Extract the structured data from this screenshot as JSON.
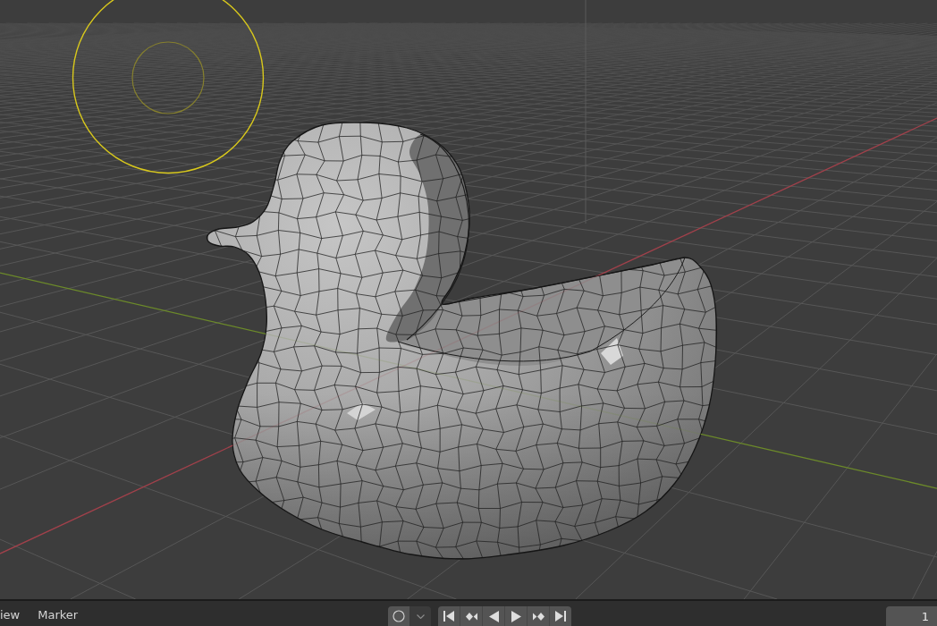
{
  "timeline": {
    "menus": [
      {
        "label": "iew"
      },
      {
        "label": "Marker"
      }
    ],
    "auto_keying": {
      "on": false
    },
    "playback_buttons": [
      {
        "kind": "jump_start"
      },
      {
        "kind": "prev_keyframe"
      },
      {
        "kind": "play_reverse"
      },
      {
        "kind": "play"
      },
      {
        "kind": "next_keyframe"
      },
      {
        "kind": "jump_end"
      }
    ],
    "current_frame": "1"
  }
}
